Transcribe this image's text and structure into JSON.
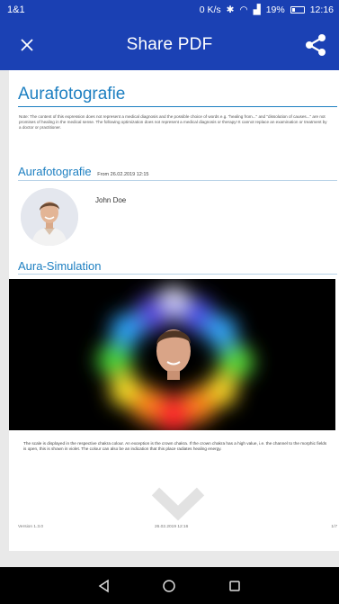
{
  "status_bar": {
    "carrier": "1&1",
    "speed": "0 K/s",
    "signal": "19%",
    "time": "12:16"
  },
  "app_bar": {
    "title": "Share PDF"
  },
  "document": {
    "title": "Aurafotografie",
    "note": "Note: The content of this expression does not represent a medical diagnosis and the possible choice of words e.g. \"healing from...\" and \"dissolution of causes...\" are not promises of healing in the medical sense. The following optimization does not represent a medical diagnosis or therapy! It cannot replace an examination or treatment by a doctor or practitioner.",
    "section1_title": "Aurafotografie",
    "section1_date": "From 26.02.2019 12:15",
    "patient_name": "John Doe",
    "section2_title": "Aura-Simulation",
    "caption": "The scale is displayed in the respective chakra colour. An exception is the crown chakra. If the crown chakra has a high value, i.e. the channel to the morphic fields is open, this is shown in violet. The colour can also be an indication that this place radiates healing energy.",
    "footer_version": "Version 1.3.0",
    "footer_datetime": "26.02.2019 12:16",
    "footer_page": "1/7"
  },
  "colors": {
    "app_bar": "#1b41b4",
    "accent_text": "#1d7fc1"
  },
  "icons": {
    "close": "close-icon",
    "share": "share-icon",
    "back": "back-triangle-icon",
    "home": "home-circle-icon",
    "recents": "recents-square-icon"
  }
}
